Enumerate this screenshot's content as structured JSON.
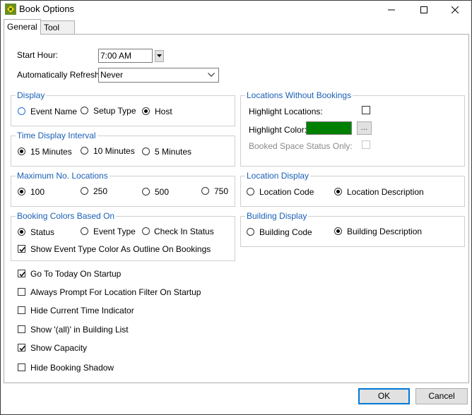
{
  "window": {
    "title": "Book Options"
  },
  "tabs": [
    {
      "label": "General",
      "active": true
    },
    {
      "label": "Tool Tip Display",
      "active": false
    }
  ],
  "top_fields": {
    "start_hour_label": "Start Hour:",
    "start_hour_value": "7:00 AM",
    "auto_refresh_label": "Automatically Refresh:",
    "auto_refresh_value": "Never"
  },
  "display": {
    "legend": "Display",
    "options": [
      "Event Name",
      "Setup Type",
      "Host"
    ],
    "selected": "Host"
  },
  "time_interval": {
    "legend": "Time Display Interval",
    "options": [
      "15 Minutes",
      "10 Minutes",
      "5 Minutes"
    ],
    "selected": "15 Minutes"
  },
  "max_locations": {
    "legend": "Maximum No. Locations",
    "options": [
      "100",
      "250",
      "500",
      "750"
    ],
    "selected": "100"
  },
  "booking_colors": {
    "legend": "Booking Colors Based On",
    "options": [
      "Status",
      "Event Type",
      "Check In Status"
    ],
    "selected": "Status",
    "outline_label": "Show Event Type Color As Outline On Bookings",
    "outline_checked": true
  },
  "locations_without_bookings": {
    "legend": "Locations Without Bookings",
    "highlight_locations_label": "Highlight Locations:",
    "highlight_locations_checked": false,
    "highlight_color_label": "Highlight Color:",
    "highlight_color": "#008000",
    "browse_label": "...",
    "booked_space_label": "Booked Space Status Only:",
    "booked_space_checked": false
  },
  "location_display": {
    "legend": "Location Display",
    "options": [
      "Location Code",
      "Location Description"
    ],
    "selected": "Location Description"
  },
  "building_display": {
    "legend": "Building Display",
    "options": [
      "Building Code",
      "Building Description"
    ],
    "selected": "Building Description"
  },
  "checkboxes": [
    {
      "label": "Go To Today On Startup",
      "checked": true
    },
    {
      "label": "Always Prompt For Location Filter On Startup",
      "checked": false
    },
    {
      "label": "Hide Current Time Indicator",
      "checked": false
    },
    {
      "label": "Show '(all)' in Building List",
      "checked": false
    },
    {
      "label": "Show Capacity",
      "checked": true
    },
    {
      "label": "Hide Booking Shadow",
      "checked": false
    }
  ],
  "buttons": {
    "ok": "OK",
    "cancel": "Cancel"
  },
  "colors": {
    "accent": "#1a5fb4",
    "focus": "#0078d7"
  }
}
